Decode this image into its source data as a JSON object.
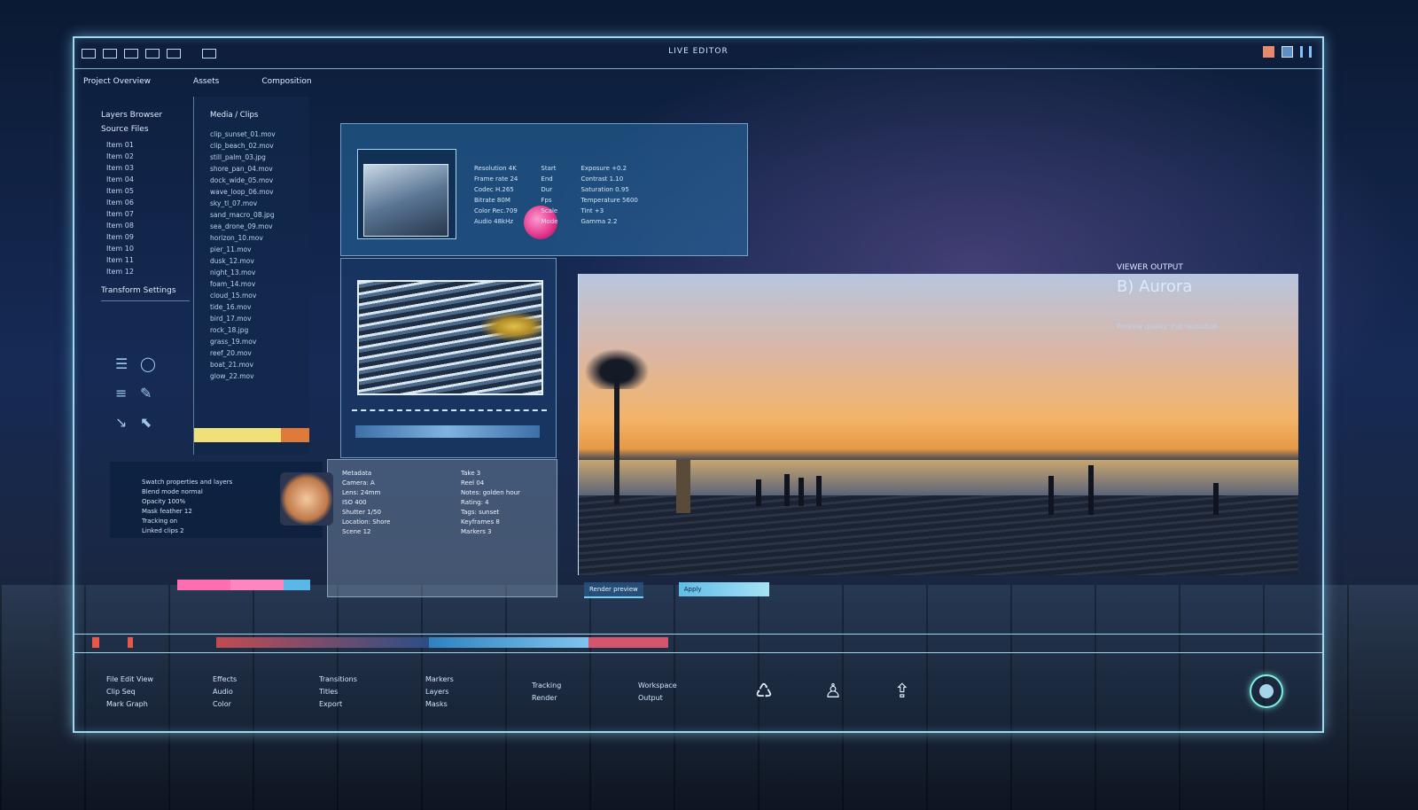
{
  "window": {
    "title": "LIVE EDITOR"
  },
  "menubar": [
    "Project Overview",
    "Assets",
    "Composition"
  ],
  "sidebar": {
    "head1": "Layers Browser",
    "head2": "Source Files",
    "items": [
      "Item 01",
      "Item 02",
      "Item 03",
      "Item 04",
      "Item 05",
      "Item 06",
      "Item 07",
      "Item 08",
      "Item 09",
      "Item 10",
      "Item 11",
      "Item 12"
    ],
    "footer": "Transform Settings"
  },
  "filelist": {
    "header": "Media / Clips",
    "rows": [
      "clip_sunset_01.mov",
      "clip_beach_02.mov",
      "still_palm_03.jpg",
      "shore_pan_04.mov",
      "dock_wide_05.mov",
      "wave_loop_06.mov",
      "sky_tl_07.mov",
      "sand_macro_08.jpg",
      "sea_drone_09.mov",
      "horizon_10.mov",
      "pier_11.mov",
      "dusk_12.mov",
      "night_13.mov",
      "foam_14.mov",
      "cloud_15.mov",
      "tide_16.mov",
      "bird_17.mov",
      "rock_18.jpg",
      "grass_19.mov",
      "reef_20.mov",
      "boat_21.mov",
      "glow_22.mov"
    ]
  },
  "panel_top": {
    "cols": [
      [
        "Resolution 4K",
        "Frame rate 24",
        "Codec H.265",
        "Bitrate 80M",
        "Color Rec.709",
        "Audio 48kHz"
      ],
      [
        "Start",
        "End",
        "Dur",
        "Fps",
        "Scale",
        "Mode"
      ],
      [
        "Exposure +0.2",
        "Contrast 1.10",
        "Saturation 0.95",
        "Temperature 5600",
        "Tint +3",
        "Gamma 2.2"
      ]
    ]
  },
  "panel_bottom": {
    "lines": [
      "Metadata",
      "Camera: A",
      "Lens: 24mm",
      "ISO 400",
      "Shutter 1/50",
      "Location: Shore",
      "Scene 12",
      "Take 3",
      "Reel 04",
      "Notes: golden hour",
      "Rating: 4",
      "Tags: sunset",
      "Keyframes 8",
      "Markers 3"
    ]
  },
  "panel_small": {
    "lines": [
      "Swatch properties and layers",
      "Blend mode normal",
      "Opacity 100%",
      "Mask feather 12",
      "Tracking on",
      "Linked clips 2"
    ]
  },
  "info": {
    "label": "VIEWER OUTPUT",
    "value": "B) Aurora",
    "sub": "Preview quality: Full resolution"
  },
  "preview_buttons": [
    "Render preview",
    "Apply"
  ],
  "dock": {
    "groups": [
      [
        "File Edit View",
        "Clip Seq",
        "Mark Graph"
      ],
      [
        "Effects",
        "Audio",
        "Color"
      ],
      [
        "Transitions",
        "Titles",
        "Export"
      ],
      [
        "Markers",
        "Layers",
        "Masks"
      ],
      [
        "Tracking",
        "Render"
      ],
      [
        "Workspace",
        "Output"
      ]
    ],
    "icons": [
      "gift-icon",
      "user-icon",
      "share-icon"
    ]
  },
  "colors": {
    "accent": "#9fd6f0",
    "pink": "#ff6fb0",
    "yellow": "#f0e07a",
    "cyan": "#7ef0e4"
  }
}
